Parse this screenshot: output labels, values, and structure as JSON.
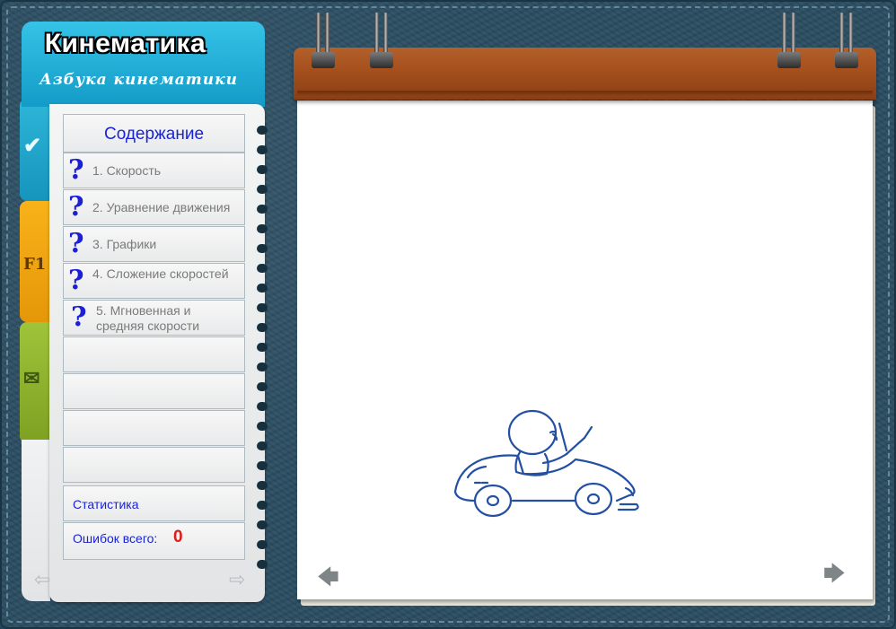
{
  "app": {
    "title": "Кинематика",
    "subtitle": "Азбука кинематики"
  },
  "side_tabs": [
    {
      "name": "check",
      "icon": "checkmark-icon",
      "color": "#1ea7d0"
    },
    {
      "name": "f1",
      "icon": "f1-help-icon",
      "color": "#f2a40f",
      "text": "F1"
    },
    {
      "name": "mail",
      "icon": "envelope-icon",
      "color": "#8cb22c"
    }
  ],
  "contents": {
    "heading": "Содержание",
    "items": [
      {
        "label": "1. Скорость"
      },
      {
        "label": "2. Уравнение движения"
      },
      {
        "label": "3. Графики"
      },
      {
        "label": "4. Сложение скоростей"
      },
      {
        "label": "5. Мгновенная и средняя скорости"
      }
    ],
    "statistics_label": "Статистика",
    "errors_label": "Ошибок всего:",
    "errors_count": "0"
  },
  "colors": {
    "accent_blue": "#1a23d6",
    "error_red": "#e01b1b",
    "binder_brown": "#a44f1c"
  },
  "illustration": {
    "icon": "cartoon-car-driver-illustration"
  }
}
